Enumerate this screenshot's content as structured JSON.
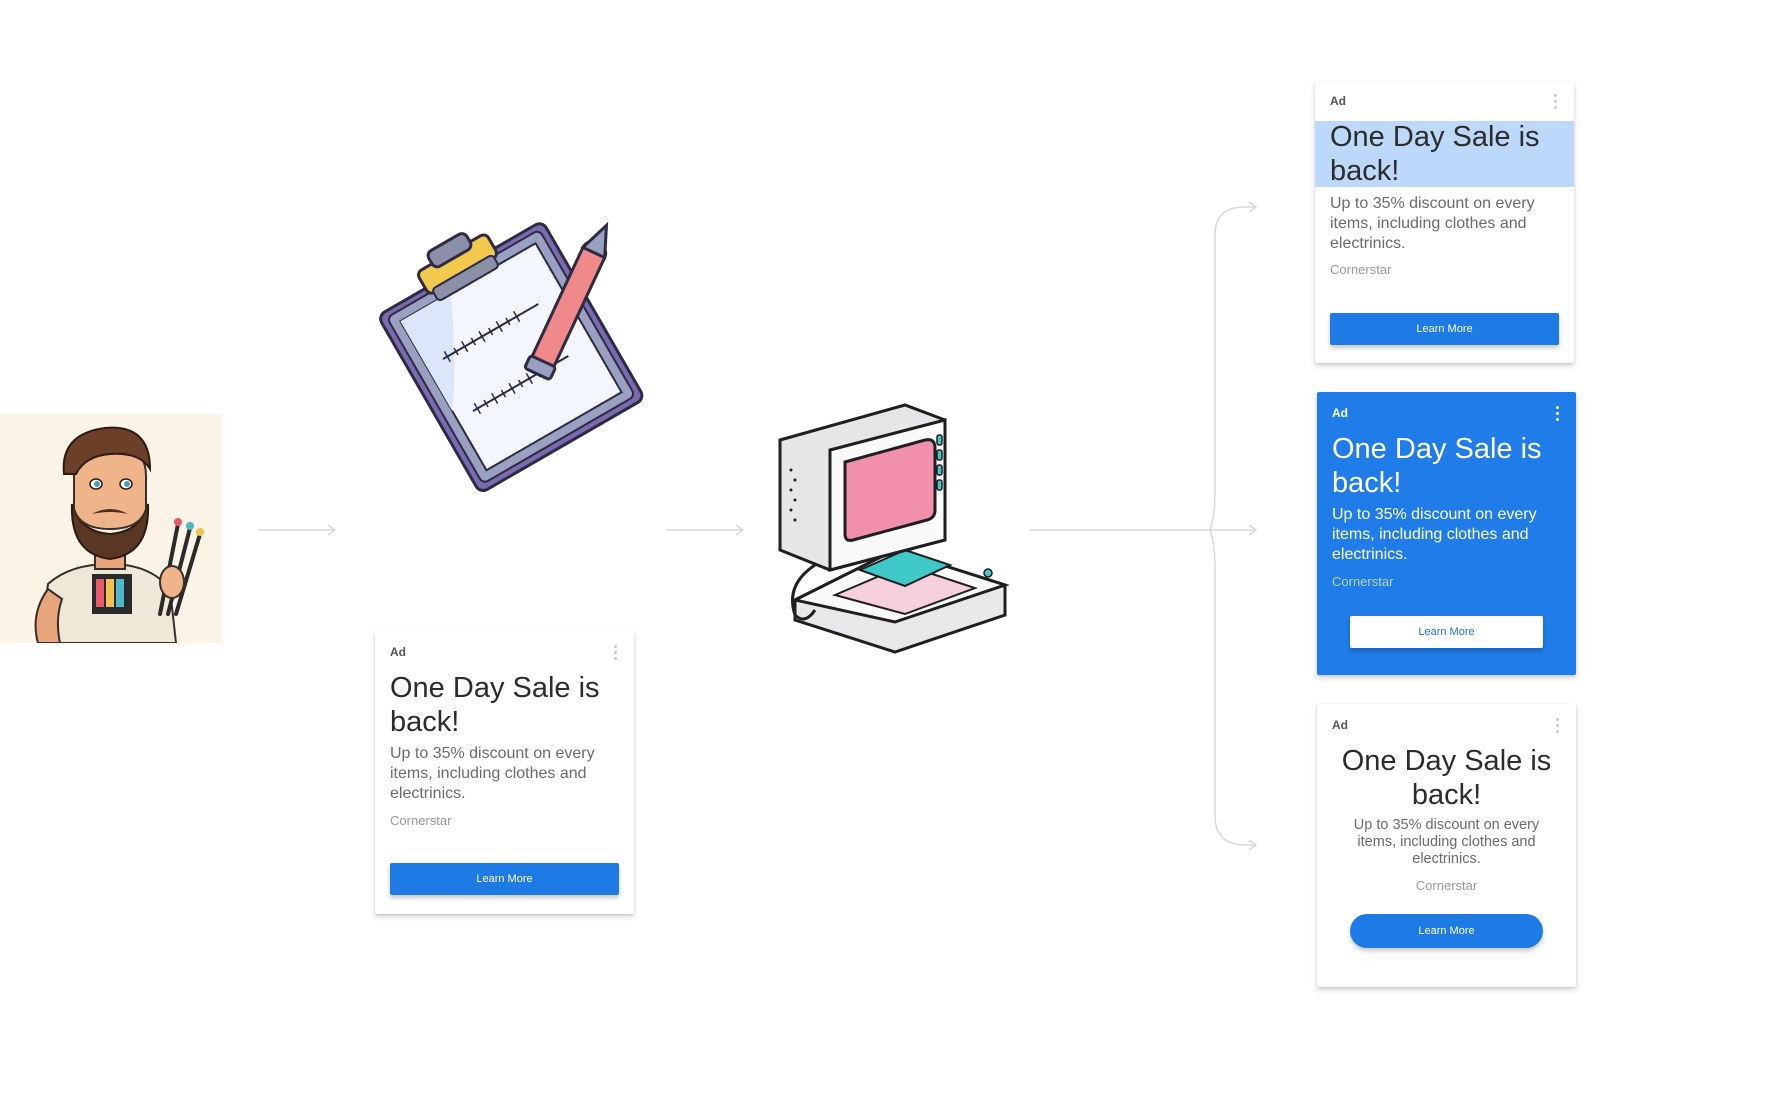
{
  "ad": {
    "label": "Ad",
    "title": "One Day Sale is back!",
    "description": "Up to 35% discount on every items, including clothes and electrinics.",
    "brand": "Cornerstar",
    "cta": "Learn More"
  },
  "colors": {
    "accent_blue": "#1f7ce8",
    "highlight_blue": "#bcd9fb",
    "arrow_gray": "#d9d9d9",
    "avatar_bg": "#fcf4e6",
    "screen_pink": "#f290ac",
    "keyboard_teal": "#3ec8c8"
  },
  "icons": {
    "designer": "bearded-designer-illustration",
    "clipboard": "clipboard-pen-ruler-illustration",
    "computer": "retro-computer-illustration"
  }
}
